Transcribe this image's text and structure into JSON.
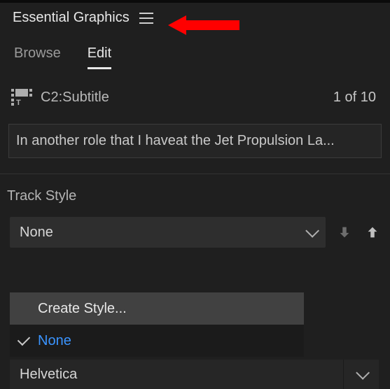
{
  "panel": {
    "title": "Essential Graphics"
  },
  "tabs": {
    "browse": "Browse",
    "edit": "Edit"
  },
  "clip": {
    "name": "C2:Subtitle",
    "count": "1 of 10"
  },
  "caption": {
    "text": "In another role that I haveat the Jet Propulsion La..."
  },
  "trackStyle": {
    "label": "Track Style",
    "selected": "None",
    "menu": {
      "create": "Create Style...",
      "none": "None"
    }
  },
  "font": {
    "family": "Helvetica"
  }
}
